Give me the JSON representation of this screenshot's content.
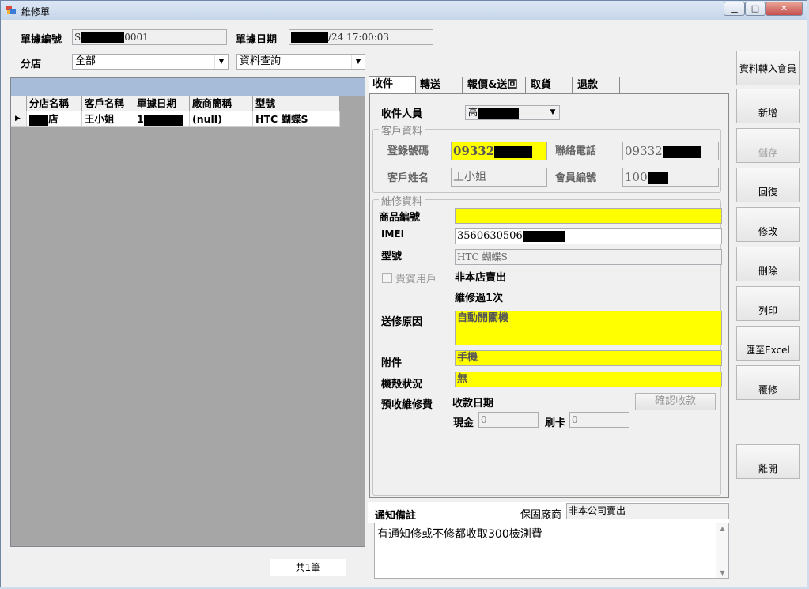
{
  "window": {
    "title": "維修單",
    "buttons": {
      "minimize": "▁",
      "maximize": "□",
      "close": "✕"
    }
  },
  "header": {
    "doc_no_label": "單據編號",
    "doc_no_value_prefix": "S",
    "doc_no_value_suffix": "0001",
    "doc_date_label": "單據日期",
    "doc_date_value_suffix": "/24 17:00:03",
    "branch_label": "分店",
    "branch_value": "全部",
    "query_value": "資料查詢"
  },
  "grid": {
    "columns": [
      "分店名稱",
      "客戶名稱",
      "單據日期",
      "廠商簡稱",
      "型號"
    ],
    "row": {
      "indicator": "▶",
      "branch_suffix": "店",
      "customer": "王小姐",
      "date_prefix": "1",
      "vendor": "(null)",
      "model": "HTC 蝴蝶S"
    },
    "count_text": "共1筆"
  },
  "tabs": [
    "收件",
    "轉送",
    "報價&送回",
    "取貨",
    "退款"
  ],
  "receipt": {
    "receiver_label": "收件人員",
    "receiver_value_prefix": "高",
    "customer_group_title": "客戶資料",
    "login_label": "登錄號碼",
    "login_value_prefix": "09332",
    "phone_label": "聯絡電話",
    "phone_value_prefix": "09332",
    "name_label": "客戶姓名",
    "name_value": "王小姐",
    "member_label": "會員編號",
    "member_value_prefix": "100",
    "repair_group_title": "維修資料",
    "product_no_label": "商品編號",
    "product_no_value": "",
    "imei_label": "IMEI",
    "imei_value_prefix": "3560630506",
    "model_label": "型號",
    "model_value": "HTC 蝴蝶S",
    "vip_label": "貴賓用戶",
    "not_sold_text": "非本店賣出",
    "repaired_text": "維修過1次",
    "reason_label": "送修原因",
    "reason_value": "自動開關機",
    "accessory_label": "附件",
    "accessory_value": "手機",
    "condition_label": "機殼狀況",
    "condition_value": "無",
    "prepay_label": "預收維修費",
    "pay_date_label": "收款日期",
    "confirm_button": "確認收款",
    "cash_label": "現金",
    "cash_value": "0",
    "card_label": "刷卡",
    "card_value": "0"
  },
  "notes": {
    "label": "通知備註",
    "warranty_label": "保固廠商",
    "warranty_value": "非本公司賣出",
    "text": "有通知修或不修都收取300檢測費"
  },
  "side_buttons": [
    "資料轉入會員",
    "新增",
    "儲存",
    "回復",
    "修改",
    "刪除",
    "列印",
    "匯至Excel",
    "覆修",
    "離開"
  ],
  "colors": {
    "highlight_yellow": "#ffff00",
    "grid_background": "#a6a6a6"
  }
}
